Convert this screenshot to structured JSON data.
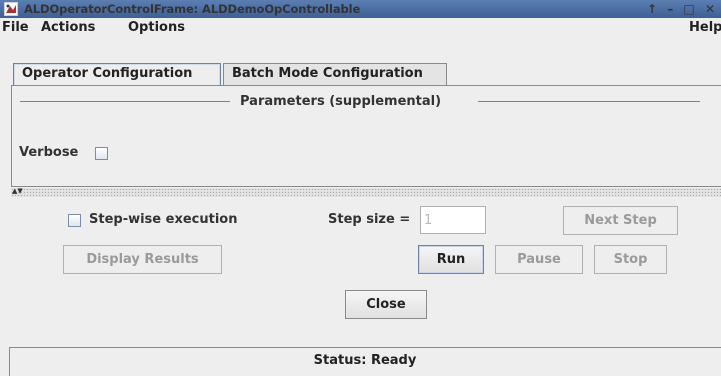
{
  "window": {
    "title": "ALDOperatorControlFrame: ALDDemoOpControllable",
    "controls": {
      "up": "↑",
      "minimize": "–",
      "maximize": "□",
      "close": "✕"
    }
  },
  "menu": {
    "file": "File",
    "actions": "Actions",
    "options": "Options",
    "help": "Help"
  },
  "tabs": [
    {
      "label": "Operator Configuration",
      "selected": true
    },
    {
      "label": "Batch Mode Configuration",
      "selected": false
    }
  ],
  "parameters": {
    "title": "Parameters (supplemental)",
    "verbose_label": "Verbose",
    "verbose_checked": false
  },
  "execution": {
    "stepwise_label": "Step-wise execution",
    "stepwise_checked": false,
    "step_size_label": "Step size =",
    "step_size_value": "1",
    "next_step": "Next Step",
    "display_results": "Display Results",
    "run": "Run",
    "pause": "Pause",
    "stop": "Stop",
    "close": "Close"
  },
  "status": {
    "text": "Status: Ready"
  },
  "colors": {
    "titlebar": "#4a6ea5",
    "focus_border": "#6b84a8"
  }
}
